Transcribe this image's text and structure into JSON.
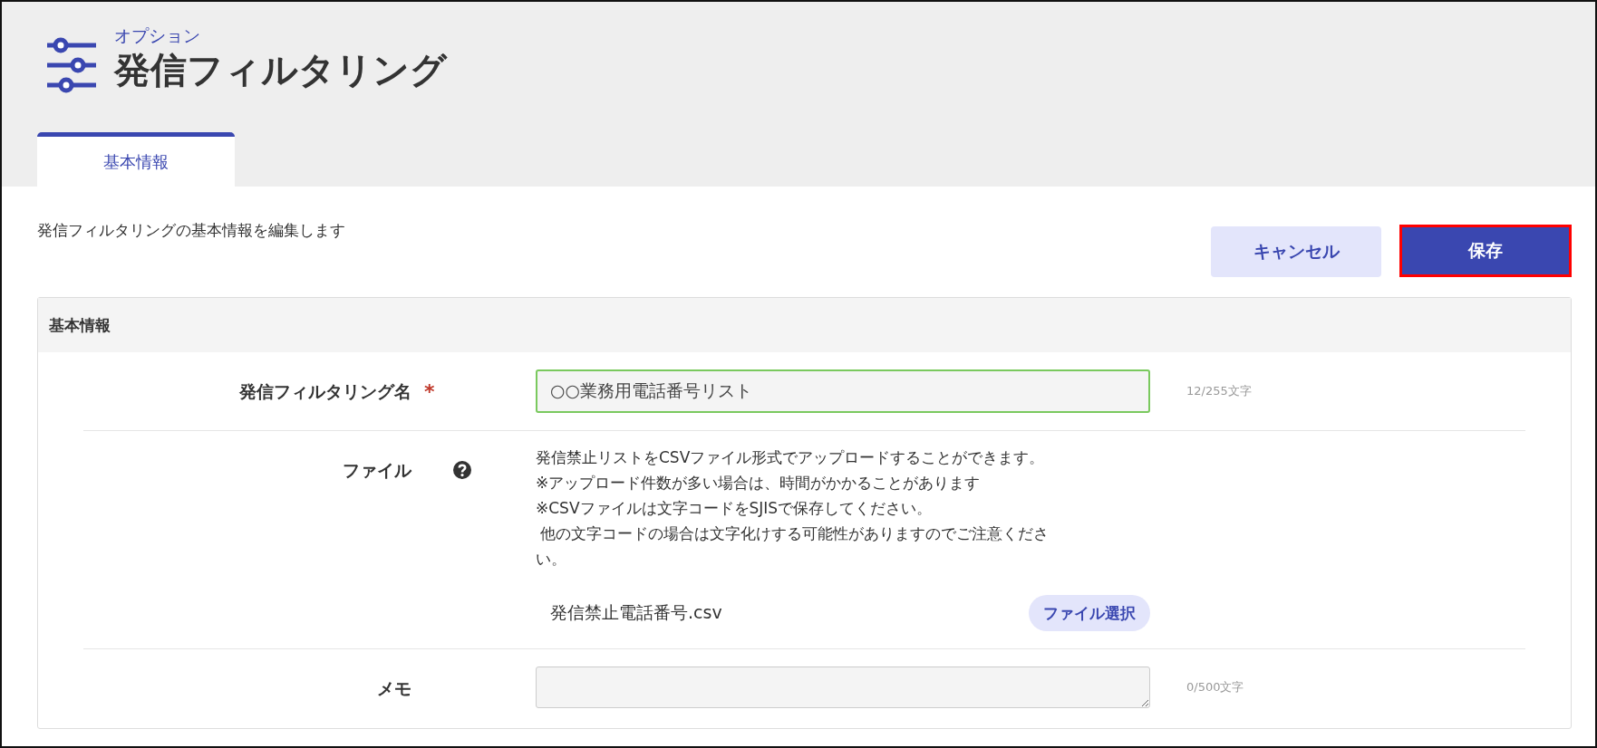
{
  "header": {
    "subtitle": "オプション",
    "title": "発信フィルタリング"
  },
  "tabs": [
    {
      "label": "基本情報",
      "selected": true
    }
  ],
  "description": "発信フィルタリングの基本情報を編集します",
  "buttons": [
    {
      "label": "キャンセル",
      "kind": "secondary",
      "highlighted": false
    },
    {
      "label": "保存",
      "kind": "primary",
      "highlighted": true
    }
  ],
  "panel": {
    "title": "基本情報",
    "fields": [
      {
        "kind": "text",
        "label": "発信フィルタリング名",
        "required_mark": "*",
        "value": "○○業務用電話番号リスト",
        "valid": true,
        "counter": "12/255文字"
      },
      {
        "kind": "file",
        "label": "ファイル",
        "help": true,
        "notes": [
          "発信禁止リストをCSVファイル形式でアップロードすることができます。",
          "※アップロード件数が多い場合は、時間がかかることがあります",
          "※CSVファイルは文字コードをSJISで保存してください。",
          " 他の文字コードの場合は文字化けする可能性がありますのでご注意くださ",
          "い。"
        ],
        "file_name": "発信禁止電話番号.csv",
        "button": "ファイル選択"
      },
      {
        "kind": "textarea",
        "label": "メモ",
        "counter": "0/500文字"
      }
    ]
  }
}
